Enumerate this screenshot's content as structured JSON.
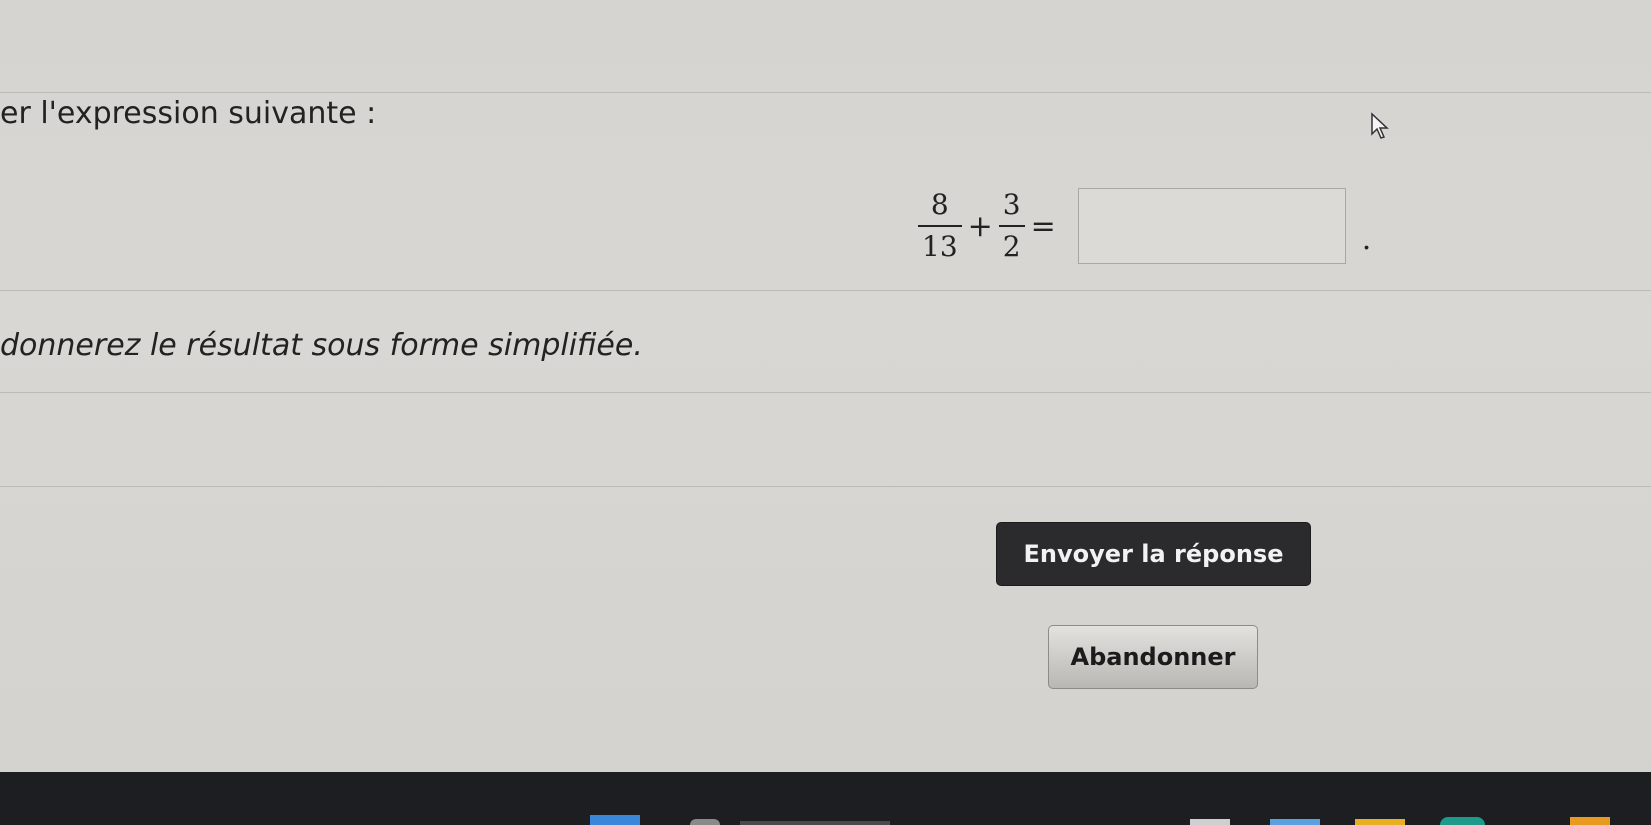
{
  "header": {
    "title_fragment": ""
  },
  "question": {
    "prompt": "er l'expression suivante :",
    "fraction_1": {
      "numerator": "8",
      "denominator": "13"
    },
    "plus": "+",
    "fraction_2": {
      "numerator": "3",
      "denominator": "2"
    },
    "equals": "=",
    "answer_placeholder": "",
    "period": ".",
    "instruction": "donnerez le résultat sous forme simplifiée."
  },
  "actions": {
    "submit_label": "Envoyer la réponse",
    "abandon_label": "Abandonner"
  },
  "taskbar": {
    "icons": [
      "windows-start-icon",
      "search-icon",
      "taskview-icon",
      "file-explorer-icon",
      "folder-icon",
      "browser-icon",
      "app-icon"
    ]
  },
  "colors": {
    "submit_bg": "#2b2b2d",
    "abandon_bg": "#cfcdc9",
    "page_bg": "#d6d4d0",
    "taskbar_bg": "#1d1e22"
  }
}
